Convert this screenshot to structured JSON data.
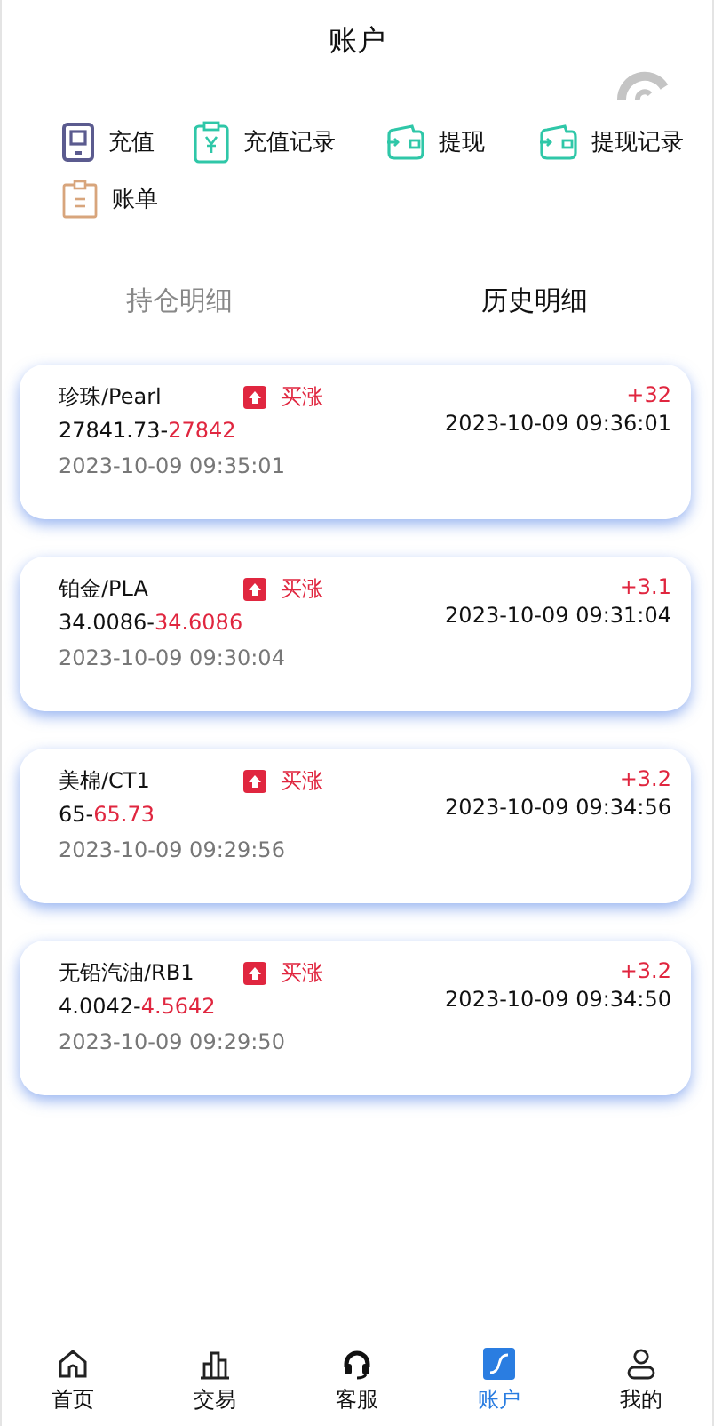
{
  "header": {
    "title": "账户"
  },
  "menu": [
    {
      "label": "充值",
      "kind": "phone"
    },
    {
      "label": "充值记录",
      "kind": "clipboard-yen"
    },
    {
      "label": "提现",
      "kind": "wallet"
    },
    {
      "label": "提现记录",
      "kind": "wallet"
    },
    {
      "label": "账单",
      "kind": "clipboard"
    }
  ],
  "tabs": [
    {
      "label": "持仓明细",
      "selected": false
    },
    {
      "label": "历史明细",
      "selected": true
    }
  ],
  "orders": [
    {
      "name": "珍珠/Pearl",
      "rising": true,
      "direction_label": "买涨",
      "open_price": "27841.73-",
      "close_price": "27842",
      "open_time": "2023-10-09 09:35:01",
      "profit": "+32",
      "close_time": "2023-10-09 09:36:01"
    },
    {
      "name": "铂金/PLA",
      "rising": true,
      "direction_label": "买涨",
      "open_price": "34.0086-",
      "close_price": "34.6086",
      "open_time": "2023-10-09 09:30:04",
      "profit": "+3.1",
      "close_time": "2023-10-09 09:31:04"
    },
    {
      "name": "美棉/CT1",
      "rising": true,
      "direction_label": "买涨",
      "open_price": "65-",
      "close_price": "65.73",
      "open_time": "2023-10-09 09:29:56",
      "profit": "+3.2",
      "close_time": "2023-10-09 09:34:56"
    },
    {
      "name": "无铅汽油/RB1",
      "rising": true,
      "direction_label": "买涨",
      "open_price": "4.0042-",
      "close_price": "4.5642",
      "open_time": "2023-10-09 09:29:50",
      "profit": "+3.2",
      "close_time": "2023-10-09 09:34:50"
    }
  ],
  "bottom_nav": [
    {
      "label": "首页",
      "kind": "home",
      "selected": false
    },
    {
      "label": "交易",
      "kind": "chart",
      "selected": false
    },
    {
      "label": "客服",
      "kind": "headset",
      "selected": false
    },
    {
      "label": "账户",
      "kind": "account",
      "selected": true
    },
    {
      "label": "我的",
      "kind": "user",
      "selected": false
    }
  ]
}
